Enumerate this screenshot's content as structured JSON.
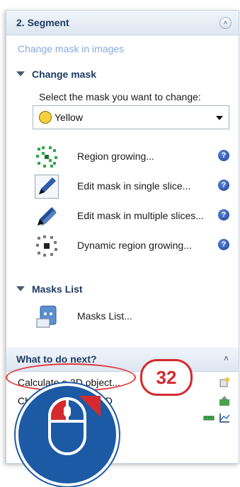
{
  "segment": {
    "title": "2. Segment",
    "collapse_icon": "double-chevron-up-icon",
    "hint": "Change mask in images"
  },
  "change_mask": {
    "title": "Change mask",
    "prompt": "Select the mask you want to change:",
    "selected_mask": "Yellow",
    "items": [
      {
        "label": "Region growing...",
        "icon": "region-growing-icon"
      },
      {
        "label": "Edit mask in single slice...",
        "icon": "pencil-icon"
      },
      {
        "label": "Edit mask in multiple slices...",
        "icon": "pencil-multiple-icon"
      },
      {
        "label": "Dynamic region growing...",
        "icon": "dynamic-region-growing-icon"
      }
    ]
  },
  "masks_list": {
    "title": "Masks List",
    "item_label": "Masks List..."
  },
  "what_next": {
    "title": "What to do next?",
    "items": [
      "Calculate a 3D object...",
      "Ch",
      "3D"
    ]
  },
  "annotation": {
    "step_number": "32",
    "accent_color": "#d42a2f",
    "mouse_color": "#1d5aa6"
  }
}
